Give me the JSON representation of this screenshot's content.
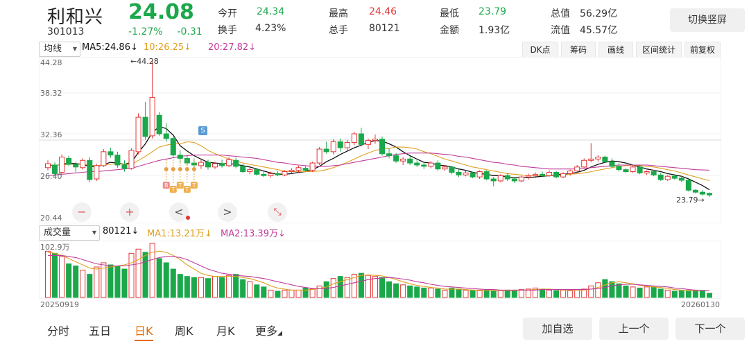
{
  "header": {
    "name": "利和兴",
    "code": "301013",
    "price": "24.08",
    "change_pct": "-1.27%",
    "change_amt": "-0.31",
    "switch_button": "切换竖屏"
  },
  "stats": [
    {
      "label": "今开",
      "value": "24.34",
      "color": "#1aa84a"
    },
    {
      "label": "最高",
      "value": "24.46",
      "color": "#e23636"
    },
    {
      "label": "最低",
      "value": "23.79",
      "color": "#1aa84a"
    },
    {
      "label": "总值",
      "value": "56.29亿",
      "color": "#333333"
    },
    {
      "label": "换手",
      "value": "4.23%",
      "color": "#333333"
    },
    {
      "label": "总手",
      "value": "80121",
      "color": "#333333"
    },
    {
      "label": "金额",
      "value": "1.93亿",
      "color": "#333333"
    },
    {
      "label": "流值",
      "value": "45.57亿",
      "color": "#333333"
    }
  ],
  "price_toolbar": {
    "indicator_select": "均线",
    "ma5": "MA5:24.86",
    "ma10": "10:26.25",
    "ma20": "20:27.82",
    "arrow": "↓",
    "buttons": [
      "DK点",
      "筹码",
      "画线",
      "区间统计",
      "前复权"
    ]
  },
  "volume_toolbar": {
    "indicator_select": "成交量",
    "vol": "80121",
    "ma1": "MA1:13.21万",
    "ma2": "MA2:13.39万",
    "arrow": "↓"
  },
  "axes": {
    "price_top": "44.28",
    "price_2": "38.32",
    "price_3": "32.36",
    "price_4": "26.40",
    "price_bottom": "20.44",
    "volume_top": "102.9万",
    "date_start": "20250919",
    "date_end": "20260130",
    "high_marker": "←44.28",
    "low_marker": "23.79→",
    "s_badge": "S"
  },
  "chart_controls": [
    "−",
    "+",
    "<",
    ">",
    "⤡"
  ],
  "bottom_tabs": [
    "分时",
    "五日",
    "日K",
    "周K",
    "月K",
    "更多"
  ],
  "bottom_buttons": [
    "加自选",
    "上一个",
    "下一个"
  ],
  "colors": {
    "up": "#e23636",
    "down": "#1aa84a",
    "ma5": "#111111",
    "ma10": "#e0a020",
    "ma20": "#c03c9a"
  },
  "chart_data": {
    "type": "candlestick",
    "x_range": [
      "20250919",
      "20260130"
    ],
    "ylim": [
      20.44,
      44.28
    ],
    "y_ticks": [
      44.28,
      38.32,
      32.36,
      26.4,
      20.44
    ],
    "annotations": [
      "←44.28",
      "23.79→"
    ],
    "candles": [
      [
        28.2,
        29.3,
        27.8,
        28.8
      ],
      [
        28.6,
        29.0,
        26.9,
        27.3
      ],
      [
        27.5,
        30.2,
        27.2,
        29.8
      ],
      [
        29.6,
        30.0,
        28.4,
        28.7
      ],
      [
        28.7,
        29.1,
        27.5,
        28.3
      ],
      [
        28.2,
        29.6,
        27.9,
        29.3
      ],
      [
        29.3,
        29.8,
        26.0,
        26.4
      ],
      [
        26.5,
        28.8,
        26.2,
        28.5
      ],
      [
        28.5,
        31.0,
        28.3,
        30.6
      ],
      [
        30.6,
        31.2,
        29.7,
        30.1
      ],
      [
        30.1,
        30.6,
        28.2,
        28.6
      ],
      [
        28.6,
        29.3,
        27.6,
        28.1
      ],
      [
        28.1,
        31.1,
        27.9,
        30.8
      ],
      [
        30.6,
        36.4,
        30.2,
        35.8
      ],
      [
        35.8,
        38.1,
        32.4,
        32.9
      ],
      [
        33.0,
        44.28,
        32.6,
        38.8
      ],
      [
        36.1,
        36.6,
        33.0,
        33.3
      ],
      [
        33.3,
        34.9,
        32.1,
        32.6
      ],
      [
        32.6,
        32.9,
        29.8,
        30.1
      ],
      [
        30.1,
        30.8,
        29.0,
        29.6
      ],
      [
        29.6,
        30.0,
        28.5,
        28.9
      ],
      [
        28.9,
        29.6,
        28.1,
        28.6
      ],
      [
        28.5,
        29.5,
        28.0,
        29.0
      ],
      [
        29.0,
        29.4,
        27.9,
        28.3
      ],
      [
        28.3,
        29.1,
        28.0,
        28.8
      ],
      [
        28.8,
        29.4,
        28.2,
        28.5
      ],
      [
        28.5,
        29.8,
        28.3,
        29.4
      ],
      [
        29.3,
        29.7,
        28.1,
        28.4
      ],
      [
        28.4,
        28.8,
        27.4,
        27.6
      ],
      [
        27.6,
        28.2,
        27.2,
        27.9
      ],
      [
        27.9,
        28.1,
        27.0,
        27.2
      ],
      [
        27.2,
        27.6,
        26.8,
        27.0
      ],
      [
        27.0,
        27.6,
        26.7,
        27.3
      ],
      [
        27.3,
        27.7,
        26.9,
        27.1
      ],
      [
        27.1,
        27.8,
        26.9,
        27.6
      ],
      [
        27.6,
        28.1,
        27.3,
        27.8
      ],
      [
        27.8,
        28.5,
        27.5,
        28.2
      ],
      [
        28.1,
        28.4,
        27.6,
        27.8
      ],
      [
        27.8,
        29.1,
        27.6,
        28.9
      ],
      [
        28.9,
        31.3,
        28.6,
        31.0
      ],
      [
        31.0,
        32.1,
        30.3,
        30.6
      ],
      [
        30.6,
        32.5,
        30.2,
        32.1
      ],
      [
        32.1,
        32.6,
        30.6,
        31.2
      ],
      [
        31.2,
        32.4,
        30.8,
        32.0
      ],
      [
        32.0,
        33.6,
        31.6,
        33.3
      ],
      [
        33.3,
        34.2,
        31.4,
        31.7
      ],
      [
        31.7,
        32.6,
        31.0,
        32.3
      ],
      [
        32.3,
        33.2,
        31.8,
        32.5
      ],
      [
        32.5,
        32.9,
        30.0,
        30.3
      ],
      [
        30.3,
        31.1,
        29.6,
        30.0
      ],
      [
        30.0,
        30.4,
        28.9,
        29.2
      ],
      [
        29.2,
        29.8,
        28.6,
        29.5
      ],
      [
        29.5,
        29.9,
        28.6,
        28.9
      ],
      [
        28.9,
        29.3,
        28.3,
        28.6
      ],
      [
        28.6,
        29.0,
        28.0,
        28.4
      ],
      [
        28.4,
        29.2,
        28.1,
        28.9
      ],
      [
        28.9,
        29.3,
        27.7,
        28.0
      ],
      [
        28.0,
        28.6,
        27.7,
        28.3
      ],
      [
        28.3,
        28.5,
        27.2,
        27.5
      ],
      [
        27.5,
        27.9,
        26.8,
        27.1
      ],
      [
        27.1,
        27.7,
        26.9,
        27.4
      ],
      [
        27.4,
        27.6,
        26.6,
        26.8
      ],
      [
        26.8,
        27.8,
        26.5,
        27.6
      ],
      [
        27.6,
        27.8,
        26.3,
        26.5
      ],
      [
        26.5,
        26.8,
        25.4,
        26.2
      ],
      [
        26.2,
        27.2,
        26.0,
        27.0
      ],
      [
        27.0,
        27.4,
        26.2,
        26.5
      ],
      [
        26.5,
        26.8,
        25.9,
        26.2
      ],
      [
        26.2,
        27.0,
        26.0,
        26.8
      ],
      [
        26.8,
        27.3,
        26.4,
        27.0
      ],
      [
        27.0,
        27.5,
        26.6,
        27.2
      ],
      [
        27.2,
        27.6,
        26.8,
        27.0
      ],
      [
        27.0,
        27.8,
        26.8,
        27.5
      ],
      [
        27.5,
        27.7,
        26.6,
        26.8
      ],
      [
        26.8,
        27.5,
        26.6,
        27.3
      ],
      [
        27.3,
        27.9,
        27.0,
        27.7
      ],
      [
        27.7,
        28.6,
        27.4,
        28.3
      ],
      [
        28.3,
        29.6,
        28.1,
        29.3
      ],
      [
        29.3,
        31.9,
        29.0,
        29.5
      ],
      [
        29.5,
        30.1,
        29.1,
        29.8
      ],
      [
        29.8,
        30.0,
        28.9,
        29.1
      ],
      [
        29.1,
        29.6,
        28.2,
        28.4
      ],
      [
        28.4,
        28.9,
        27.6,
        27.9
      ],
      [
        27.9,
        28.1,
        27.4,
        27.6
      ],
      [
        27.6,
        28.6,
        27.4,
        28.3
      ],
      [
        28.3,
        28.6,
        27.2,
        27.4
      ],
      [
        27.4,
        27.8,
        27.1,
        27.6
      ],
      [
        27.6,
        27.9,
        26.9,
        27.1
      ],
      [
        27.1,
        27.4,
        26.2,
        26.4
      ],
      [
        26.4,
        27.1,
        26.2,
        26.9
      ],
      [
        26.9,
        27.2,
        26.4,
        26.6
      ],
      [
        26.6,
        27.0,
        26.0,
        26.3
      ],
      [
        26.3,
        26.5,
        24.6,
        24.8
      ],
      [
        24.8,
        25.0,
        24.3,
        24.5
      ],
      [
        24.5,
        24.8,
        24.0,
        24.2
      ],
      [
        24.34,
        24.46,
        23.79,
        24.08
      ]
    ],
    "series": [
      {
        "name": "MA5",
        "values": [
          28.6,
          28.5,
          28.7,
          28.9,
          28.8,
          28.7,
          28.4,
          28.3,
          28.7,
          29.0,
          28.9,
          28.7,
          29.0,
          30.5,
          31.8,
          33.5,
          34.4,
          34.1,
          33.1,
          31.5,
          30.7,
          30.0,
          29.5,
          29.0,
          28.9,
          28.8,
          28.8,
          28.7,
          28.5,
          28.3,
          28.0,
          27.7,
          27.4,
          27.2,
          27.2,
          27.3,
          27.5,
          27.6,
          27.9,
          28.4,
          29.1,
          29.6,
          30.2,
          30.7,
          31.2,
          31.6,
          32.0,
          32.3,
          32.2,
          31.8,
          31.3,
          30.6,
          30.0,
          29.5,
          29.0,
          28.9,
          28.6,
          28.5,
          28.3,
          28.0,
          27.8,
          27.5,
          27.3,
          27.2,
          27.0,
          27.0,
          26.8,
          26.7,
          26.7,
          26.7,
          26.8,
          26.9,
          27.0,
          27.1,
          27.2,
          27.3,
          27.5,
          27.8,
          28.3,
          28.7,
          29.0,
          29.2,
          29.1,
          28.9,
          28.6,
          28.3,
          28.0,
          27.8,
          27.6,
          27.3,
          27.1,
          26.9,
          26.5,
          26.0,
          25.5,
          24.86
        ]
      },
      {
        "name": "MA10",
        "values": [
          28.6,
          28.6,
          28.6,
          28.7,
          28.7,
          28.7,
          28.6,
          28.5,
          28.6,
          28.7,
          28.8,
          28.7,
          28.7,
          29.3,
          29.9,
          30.6,
          31.3,
          31.6,
          31.8,
          31.8,
          32.1,
          32.0,
          31.5,
          30.8,
          30.3,
          29.9,
          29.5,
          29.2,
          28.9,
          28.7,
          28.5,
          28.3,
          28.1,
          27.9,
          27.7,
          27.6,
          27.6,
          27.6,
          27.6,
          27.7,
          27.9,
          28.2,
          28.6,
          29.0,
          29.5,
          30.0,
          30.4,
          30.8,
          31.0,
          31.1,
          31.3,
          31.3,
          31.2,
          31.0,
          30.6,
          30.3,
          29.9,
          29.5,
          29.2,
          28.9,
          28.6,
          28.3,
          28.1,
          27.9,
          27.7,
          27.5,
          27.3,
          27.2,
          27.1,
          27.0,
          27.0,
          27.0,
          27.0,
          27.0,
          27.1,
          27.2,
          27.3,
          27.4,
          27.6,
          27.8,
          28.0,
          28.2,
          28.4,
          28.5,
          28.6,
          28.5,
          28.4,
          28.3,
          28.1,
          27.9,
          27.7,
          27.4,
          27.1,
          26.8,
          26.5,
          26.25
        ]
      },
      {
        "name": "MA20",
        "values": [
          27.0,
          27.1,
          27.2,
          27.3,
          27.4,
          27.5,
          27.6,
          27.6,
          27.7,
          27.8,
          27.9,
          28.0,
          28.1,
          28.4,
          28.7,
          29.0,
          29.3,
          29.5,
          29.7,
          29.9,
          30.0,
          30.1,
          30.1,
          30.1,
          30.1,
          30.1,
          30.0,
          29.9,
          29.8,
          29.7,
          29.6,
          29.4,
          29.2,
          29.0,
          28.9,
          28.7,
          28.6,
          28.5,
          28.4,
          28.4,
          28.4,
          28.5,
          28.6,
          28.8,
          29.0,
          29.2,
          29.4,
          29.6,
          29.8,
          30.0,
          30.2,
          30.3,
          30.4,
          30.4,
          30.4,
          30.4,
          30.3,
          30.2,
          30.1,
          29.9,
          29.8,
          29.6,
          29.4,
          29.2,
          29.0,
          28.9,
          28.7,
          28.6,
          28.4,
          28.3,
          28.2,
          28.1,
          28.0,
          28.0,
          28.0,
          28.0,
          28.0,
          28.1,
          28.2,
          28.3,
          28.4,
          28.5,
          28.6,
          28.6,
          28.6,
          28.6,
          28.6,
          28.5,
          28.4,
          28.3,
          28.2,
          28.1,
          28.0,
          27.9,
          27.85,
          27.82
        ]
      }
    ],
    "volume": {
      "unit": "万手",
      "ylim": [
        0,
        102.9
      ],
      "bars": [
        88,
        84,
        78,
        64,
        60,
        52,
        44,
        58,
        66,
        62,
        60,
        54,
        84,
        92,
        86,
        102.9,
        74,
        66,
        54,
        44,
        40,
        38,
        38,
        36,
        40,
        38,
        42,
        44,
        34,
        30,
        24,
        20,
        14,
        12,
        14,
        14,
        14,
        18,
        16,
        22,
        30,
        36,
        40,
        38,
        44,
        46,
        42,
        40,
        38,
        30,
        26,
        24,
        22,
        20,
        18,
        18,
        16,
        14,
        18,
        16,
        14,
        14,
        13,
        14,
        12,
        13,
        14,
        14,
        15,
        16,
        18,
        16,
        14,
        13,
        14,
        13,
        14,
        16,
        22,
        28,
        34,
        30,
        26,
        22,
        20,
        18,
        20,
        20,
        16,
        14,
        12,
        13,
        12,
        14,
        12,
        8
      ],
      "ma1": [
        86,
        84,
        80,
        74,
        68,
        62,
        56,
        54,
        56,
        58,
        60,
        62,
        66,
        72,
        80,
        86,
        88,
        86,
        80,
        72,
        62,
        54,
        46,
        42,
        40,
        40,
        40,
        40,
        38,
        36,
        32,
        28,
        22,
        18,
        16,
        14,
        14,
        14,
        15,
        17,
        20,
        26,
        30,
        34,
        38,
        42,
        43,
        42,
        41,
        38,
        34,
        30,
        26,
        23,
        21,
        19,
        18,
        16,
        16,
        16,
        15,
        14,
        14,
        14,
        13,
        13,
        13,
        13,
        14,
        14,
        15,
        16,
        16,
        15,
        14,
        14,
        14,
        14,
        16,
        19,
        24,
        28,
        30,
        28,
        26,
        23,
        21,
        20,
        19,
        17,
        15,
        14,
        13,
        13,
        13.2,
        13.21
      ],
      "ma2": [
        80,
        80,
        80,
        78,
        76,
        72,
        68,
        64,
        62,
        60,
        60,
        60,
        62,
        64,
        68,
        72,
        76,
        78,
        78,
        76,
        72,
        66,
        60,
        54,
        50,
        46,
        44,
        42,
        41,
        40,
        38,
        36,
        33,
        30,
        27,
        24,
        21,
        19,
        17,
        17,
        17,
        19,
        22,
        25,
        28,
        31,
        34,
        36,
        37,
        38,
        37,
        35,
        33,
        30,
        28,
        25,
        23,
        21,
        20,
        19,
        18,
        17,
        16,
        15,
        15,
        14,
        14,
        14,
        14,
        14,
        14,
        15,
        15,
        15,
        15,
        15,
        15,
        15,
        16,
        17,
        19,
        22,
        24,
        25,
        25,
        24,
        23,
        22,
        21,
        20,
        18,
        17,
        15,
        14,
        13.5,
        13.39
      ]
    }
  }
}
